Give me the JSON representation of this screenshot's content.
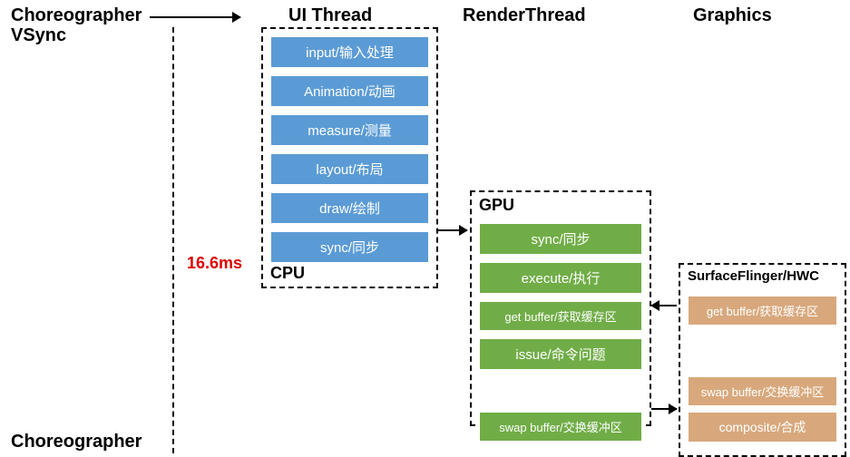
{
  "headers": {
    "choreographer": "Choreographer",
    "vsync": "VSync",
    "ui_thread": "UI Thread",
    "render_thread": "RenderThread",
    "graphics": "Graphics",
    "choreographer2": "Choreographer"
  },
  "timing": {
    "frame_interval": "16.6ms"
  },
  "cpu": {
    "title": "CPU",
    "stages": [
      "input/输入处理",
      "Animation/动画",
      "measure/测量",
      "layout/布局",
      "draw/绘制",
      "sync/同步"
    ]
  },
  "gpu": {
    "title": "GPU",
    "stages": [
      "sync/同步",
      "execute/执行",
      "get buffer/获取缓存区",
      "issue/命令问题",
      "swap buffer/交换缓冲区"
    ]
  },
  "hwc": {
    "title": "SurfaceFlinger/HWC",
    "stages": [
      "get buffer/获取缓存区",
      "swap buffer/交换缓冲区",
      "composite/合成"
    ]
  }
}
